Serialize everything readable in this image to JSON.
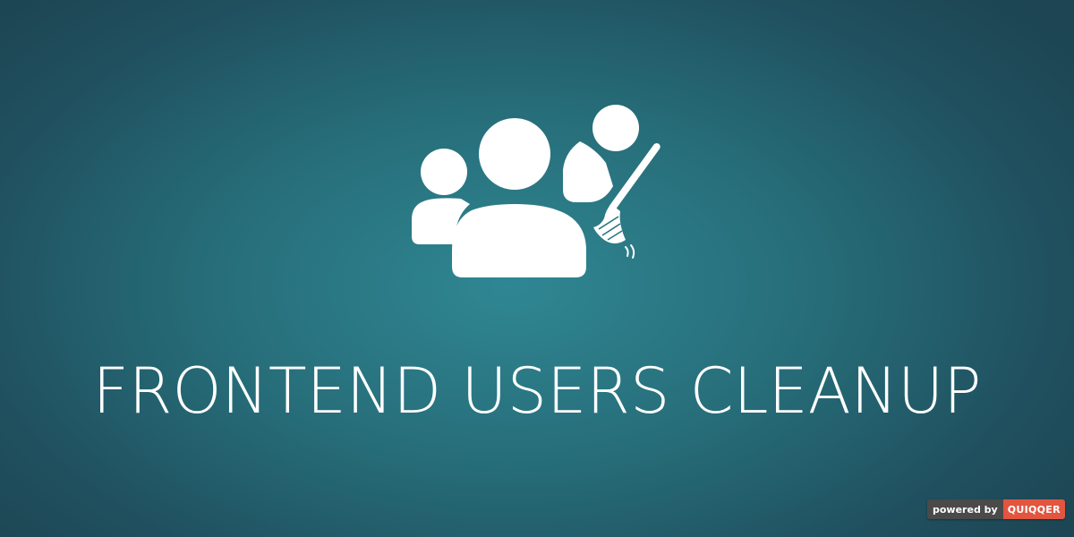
{
  "hero": {
    "icon": "users-cleanup-icon",
    "title": "FRONTEND USERS CLEANUP"
  },
  "badge": {
    "label": "powered by",
    "brand": "QUIQQER",
    "brand_color": "#e2553f",
    "label_color": "#4a4a4a"
  },
  "colors": {
    "background_center": "#2f8793",
    "background_edge": "#1d4553",
    "foreground": "#ffffff"
  }
}
